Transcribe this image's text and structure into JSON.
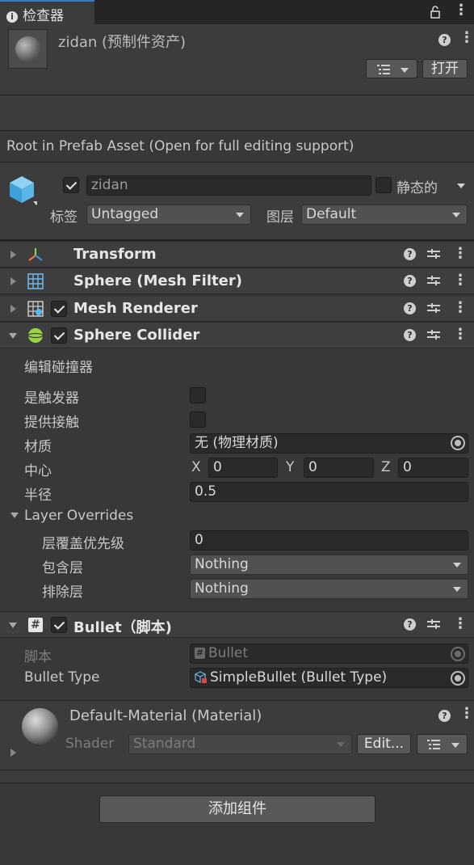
{
  "tab": {
    "label": "检查器"
  },
  "header": {
    "title": "zidan (预制件资产)",
    "open_label": "打开"
  },
  "info": {
    "text": "Root in Prefab Asset (Open for full editing support)"
  },
  "gameobject": {
    "active": true,
    "name": "zidan",
    "static_label": "静态的",
    "static": false,
    "tag_label": "标签",
    "tag_value": "Untagged",
    "layer_label": "图层",
    "layer_value": "Default"
  },
  "components": {
    "transform": {
      "title": "Transform"
    },
    "mesh_filter": {
      "title": "Sphere (Mesh Filter)"
    },
    "mesh_renderer": {
      "title": "Mesh Renderer",
      "enabled": true
    },
    "sphere_collider": {
      "title": "Sphere Collider",
      "enabled": true,
      "edit_label": "编辑碰撞器",
      "is_trigger_label": "是触发器",
      "is_trigger": false,
      "provides_contacts_label": "提供接触",
      "provides_contacts": false,
      "material_label": "材质",
      "material_value": "无 (物理材质)",
      "center_label": "中心",
      "center": {
        "x_label": "X",
        "x": "0",
        "y_label": "Y",
        "y": "0",
        "z_label": "Z",
        "z": "0"
      },
      "radius_label": "半径",
      "radius": "0.5",
      "layer_overrides_label": "Layer Overrides",
      "priority_label": "层覆盖优先级",
      "priority": "0",
      "include_label": "包含层",
      "include_value": "Nothing",
      "exclude_label": "排除层",
      "exclude_value": "Nothing"
    },
    "bullet": {
      "title": "Bullet（脚本)",
      "enabled": true,
      "script_label": "脚本",
      "script_value": "Bullet",
      "bullet_type_label": "Bullet Type",
      "bullet_type_value": "SimpleBullet (Bullet Type)"
    }
  },
  "material": {
    "name": "Default-Material (Material)",
    "shader_label": "Shader",
    "shader_value": "Standard",
    "edit_label": "Edit..."
  },
  "add_component": {
    "label": "添加组件"
  },
  "colors": {
    "accent": "#3a79bb",
    "collider_green": "#9bd442",
    "cube_blue": "#5ab6e8"
  }
}
